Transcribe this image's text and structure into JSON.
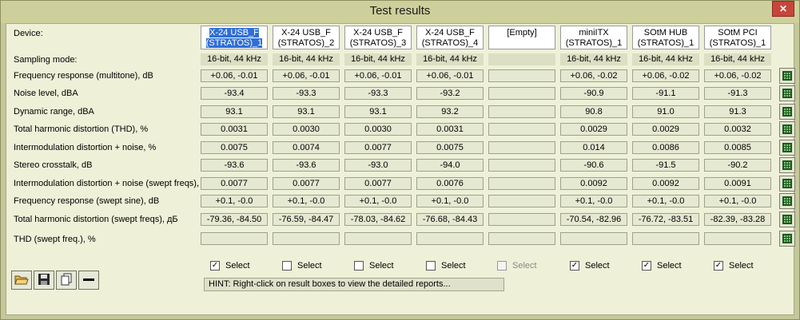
{
  "window": {
    "title": "Test results"
  },
  "labels": {
    "device": "Device:",
    "sampling": "Sampling mode:",
    "rows": [
      "Frequency response (multitone), dB",
      "Noise level, dBA",
      "Dynamic range, dBA",
      "Total harmonic distortion (THD), %",
      "Intermodulation distortion + noise, %",
      "Stereo crosstalk, dB",
      "Intermodulation distortion + noise (swept freqs), %",
      "Frequency response (swept sine), dB",
      "Total harmonic distortion (swept freqs), дБ",
      "THD (swept freq.), %"
    ]
  },
  "devices": [
    {
      "line1": "X-24 USB_F",
      "line2": "(STRATOS)_1",
      "sampling": "16-bit, 44 kHz",
      "selected": true,
      "disabled": false,
      "values": [
        "+0.06, -0.01",
        "-93.4",
        "93.1",
        "0.0031",
        "0.0075",
        "-93.6",
        "0.0077",
        "+0.1, -0.0",
        "-79.36, -84.50",
        ""
      ]
    },
    {
      "line1": "X-24 USB_F",
      "line2": "(STRATOS)_2",
      "sampling": "16-bit, 44 kHz",
      "selected": false,
      "disabled": false,
      "values": [
        "+0.06, -0.01",
        "-93.3",
        "93.1",
        "0.0030",
        "0.0074",
        "-93.6",
        "0.0077",
        "+0.1, -0.0",
        "-76.59, -84.47",
        ""
      ]
    },
    {
      "line1": "X-24 USB_F",
      "line2": "(STRATOS)_3",
      "sampling": "16-bit, 44 kHz",
      "selected": false,
      "disabled": false,
      "values": [
        "+0.06, -0.01",
        "-93.3",
        "93.1",
        "0.0030",
        "0.0077",
        "-93.0",
        "0.0077",
        "+0.1, -0.0",
        "-78.03, -84.62",
        ""
      ]
    },
    {
      "line1": "X-24 USB_F",
      "line2": "(STRATOS)_4",
      "sampling": "16-bit, 44 kHz",
      "selected": false,
      "disabled": false,
      "values": [
        "+0.06, -0.01",
        "-93.2",
        "93.2",
        "0.0031",
        "0.0075",
        "-94.0",
        "0.0076",
        "+0.1, -0.0",
        "-76.68, -84.43",
        ""
      ]
    },
    {
      "line1": "[Empty]",
      "line2": "",
      "sampling": "",
      "selected": false,
      "disabled": true,
      "values": [
        "",
        "",
        "",
        "",
        "",
        "",
        "",
        "",
        "",
        ""
      ]
    },
    {
      "line1": "miniITX",
      "line2": "(STRATOS)_1",
      "sampling": "16-bit, 44 kHz",
      "selected": true,
      "disabled": false,
      "values": [
        "+0.06, -0.02",
        "-90.9",
        "90.8",
        "0.0029",
        "0.014",
        "-90.6",
        "0.0092",
        "+0.1, -0.0",
        "-70.54, -82.96",
        ""
      ]
    },
    {
      "line1": "SOtM HUB",
      "line2": "(STRATOS)_1",
      "sampling": "16-bit, 44 kHz",
      "selected": true,
      "disabled": false,
      "values": [
        "+0.06, -0.02",
        "-91.1",
        "91.0",
        "0.0029",
        "0.0086",
        "-91.5",
        "0.0092",
        "+0.1, -0.0",
        "-76.72, -83.51",
        ""
      ]
    },
    {
      "line1": "SOtM PCI",
      "line2": "(STRATOS)_1",
      "sampling": "16-bit, 44 kHz",
      "selected": true,
      "disabled": false,
      "values": [
        "+0.06, -0.02",
        "-91.3",
        "91.3",
        "0.0032",
        "0.0085",
        "-90.2",
        "0.0091",
        "+0.1, -0.0",
        "-82.39, -83.28",
        ""
      ]
    }
  ],
  "select_label": "Select",
  "check_mark": "✓",
  "close_symbol": "✕",
  "hint": "HINT: Right-click on result boxes to view the detailed reports...",
  "toolbar": [
    {
      "name": "open-folder-button",
      "icon": "folder-open-icon"
    },
    {
      "name": "save-button",
      "icon": "floppy-disk-icon"
    },
    {
      "name": "copy-button",
      "icon": "copy-icon"
    },
    {
      "name": "remove-button",
      "icon": "minus-icon"
    }
  ]
}
